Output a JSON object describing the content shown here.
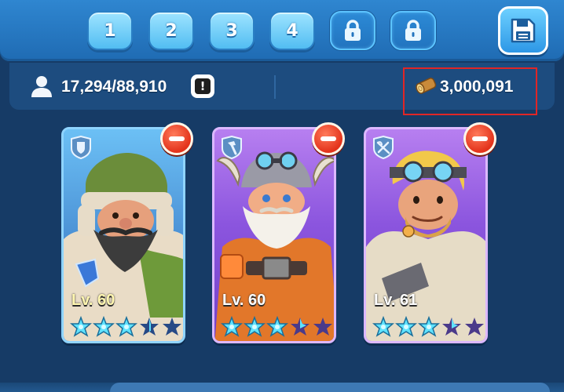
{
  "tabs": [
    {
      "label": "1",
      "locked": false
    },
    {
      "label": "2",
      "locked": false
    },
    {
      "label": "3",
      "locked": false
    },
    {
      "label": "4",
      "locked": false
    },
    {
      "label": "",
      "locked": true,
      "icon": "padlock-icon"
    },
    {
      "label": "",
      "locked": true,
      "icon": "padlock-icon"
    }
  ],
  "save_button": {
    "icon": "save-icon"
  },
  "stats": {
    "troop_count": "17,294/88,910",
    "info_icon_glyph": "!",
    "resource_value": "3,000,091",
    "resource_icon": "wood-log-icon"
  },
  "heroes": [
    {
      "level": "Lv. 60",
      "class_icon": "shield-icon",
      "card_color": "blue",
      "stars_full": 3,
      "stars_partial": 1,
      "stars_total": 5,
      "remove_icon": "remove-icon"
    },
    {
      "level": "Lv. 60",
      "class_icon": "hammer-icon",
      "card_color": "purple",
      "stars_full": 3,
      "stars_partial": 1,
      "stars_total": 5,
      "remove_icon": "remove-icon"
    },
    {
      "level": "Lv. 61",
      "class_icon": "crossbow-icon",
      "card_color": "purple",
      "stars_full": 3,
      "stars_partial": 1,
      "stars_total": 5,
      "remove_icon": "remove-icon"
    }
  ],
  "colors": {
    "background": "#163b66",
    "tab_active": "#52bdf2",
    "highlight_box": "#e12626",
    "star_filled": "#5fe3ff",
    "star_empty": "#274a86",
    "remove_button": "#e3331b"
  }
}
